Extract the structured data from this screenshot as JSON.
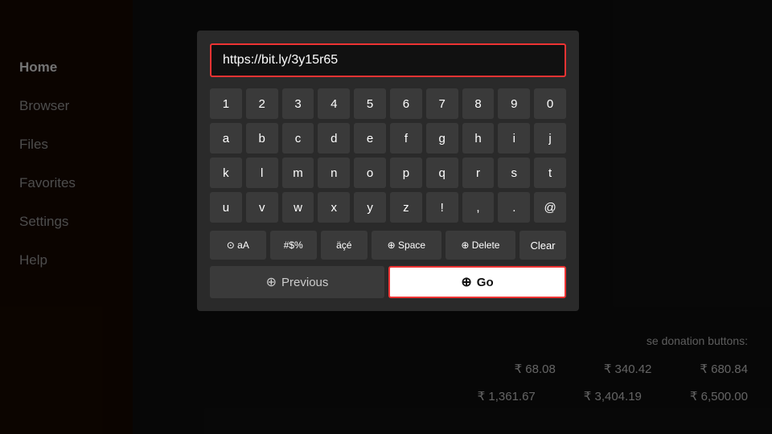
{
  "sidebar": {
    "items": [
      {
        "id": "home",
        "label": "Home",
        "active": true
      },
      {
        "id": "browser",
        "label": "Browser",
        "active": false
      },
      {
        "id": "files",
        "label": "Files",
        "active": false
      },
      {
        "id": "favorites",
        "label": "Favorites",
        "active": false
      },
      {
        "id": "settings",
        "label": "Settings",
        "active": false
      },
      {
        "id": "help",
        "label": "Help",
        "active": false
      }
    ]
  },
  "main": {
    "donation_text": "se donation buttons:",
    "prices": {
      "row1": [
        "₹ 68.08",
        "₹ 340.42",
        "₹ 680.84"
      ],
      "row2": [
        "₹ 1,361.67",
        "₹ 3,404.19",
        "₹ 6,500.00"
      ]
    }
  },
  "dialog": {
    "url_value": "https://bit.ly/3y15r65",
    "keyboard": {
      "row_numbers": [
        "1",
        "2",
        "3",
        "4",
        "5",
        "6",
        "7",
        "8",
        "9",
        "0"
      ],
      "row_alpha1": [
        "a",
        "b",
        "c",
        "d",
        "e",
        "f",
        "g",
        "h",
        "i",
        "j"
      ],
      "row_alpha2": [
        "k",
        "l",
        "m",
        "n",
        "o",
        "p",
        "q",
        "r",
        "s",
        "t"
      ],
      "row_alpha3": [
        "u",
        "v",
        "w",
        "x",
        "y",
        "z",
        "!",
        ",",
        ".",
        "@"
      ],
      "row_special": [
        {
          "label": "⊙ aA",
          "key": "capslock"
        },
        {
          "label": "#$%",
          "key": "symbols"
        },
        {
          "label": "äçé",
          "key": "accents"
        },
        {
          "label": "⊕ Space",
          "key": "space"
        },
        {
          "label": "⊕ Delete",
          "key": "delete"
        },
        {
          "label": "Clear",
          "key": "clear"
        }
      ]
    },
    "previous_label": "Previous",
    "previous_icon": "⊕",
    "go_label": "Go",
    "go_icon": "⊕"
  },
  "icons": {
    "circle_plus": "⊕",
    "circle_dot": "⊙"
  }
}
